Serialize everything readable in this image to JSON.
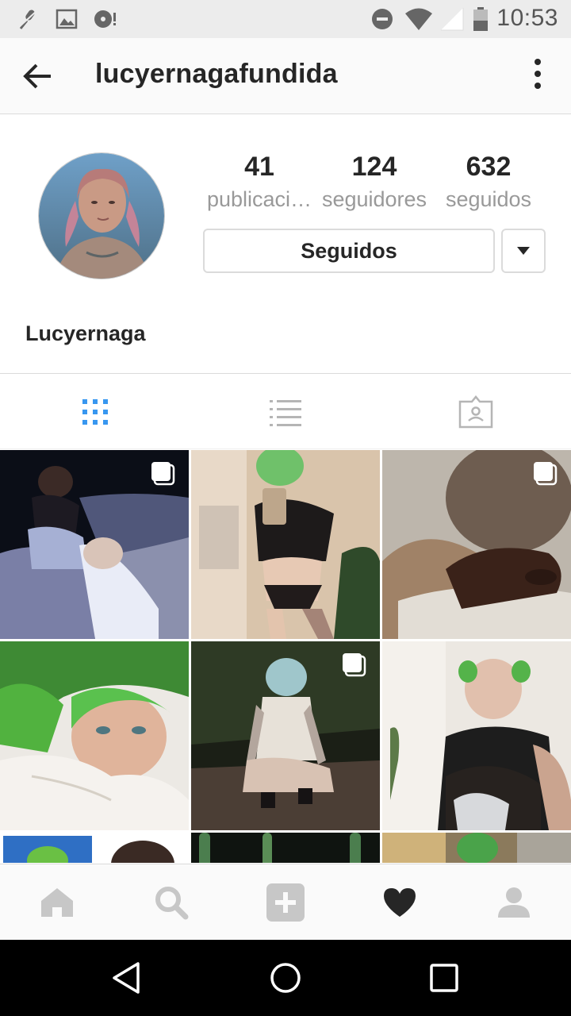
{
  "status_bar": {
    "time": "10:53",
    "left_icons": [
      "mic-off-icon",
      "image-icon",
      "vinyl-alert-icon"
    ],
    "right_icons": [
      "do-not-disturb-icon",
      "wifi-icon",
      "signal-icon",
      "battery-icon"
    ]
  },
  "header": {
    "username": "lucyernagafundida",
    "back_icon": "arrow-left-icon",
    "more_icon": "more-vertical-icon"
  },
  "profile": {
    "stats": [
      {
        "value": "41",
        "label": "publicaci…"
      },
      {
        "value": "124",
        "label": "seguidores"
      },
      {
        "value": "632",
        "label": "seguidos"
      }
    ],
    "follow_button_label": "Seguidos",
    "full_name": "Lucyernaga"
  },
  "tabs": [
    {
      "icon": "grid-icon",
      "active": true
    },
    {
      "icon": "list-icon",
      "active": false
    },
    {
      "icon": "tagged-icon",
      "active": false
    }
  ],
  "bottom_nav": [
    "home-icon",
    "search-icon",
    "add-icon",
    "heart-icon",
    "profile-icon"
  ],
  "colors": {
    "active_tab": "#3897f0",
    "inactive_icon": "#c7c7c7",
    "text_primary": "#262626",
    "text_secondary": "#999999"
  }
}
